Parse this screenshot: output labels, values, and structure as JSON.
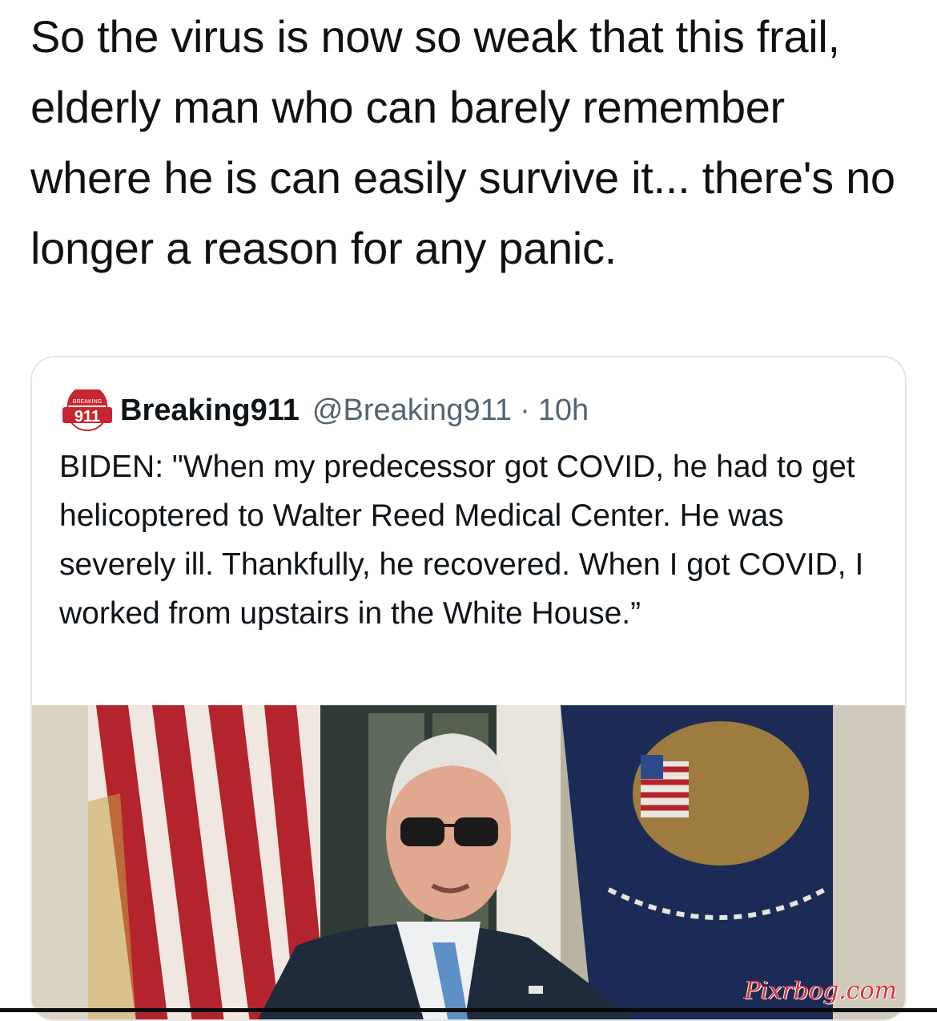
{
  "post": {
    "text": "So the virus is now so weak that this frail, elderly man who can barely remember where he is can easily survive it...  there's no longer a reason for any panic."
  },
  "quoted_tweet": {
    "avatar_icon": "breaking911-logo-icon",
    "avatar_text_top": "BREAKING",
    "avatar_text_main": "911",
    "display_name": "Breaking911",
    "handle": "@Breaking911",
    "separator": "·",
    "timestamp": "10h",
    "text": "BIDEN: \"When my predecessor got COVID, he had to get helicoptered to Walter Reed Medical Center. He was severely ill. Thankfully, he recovered. When I got COVID, I worked from upstairs in the White House.”"
  },
  "media": {
    "watermark": "Pixrbog.com"
  },
  "colors": {
    "text_primary": "#0f1419",
    "text_secondary": "#536471",
    "card_border": "#e3e7ea",
    "logo_red": "#c8262e",
    "watermark_red": "#d8323a"
  }
}
